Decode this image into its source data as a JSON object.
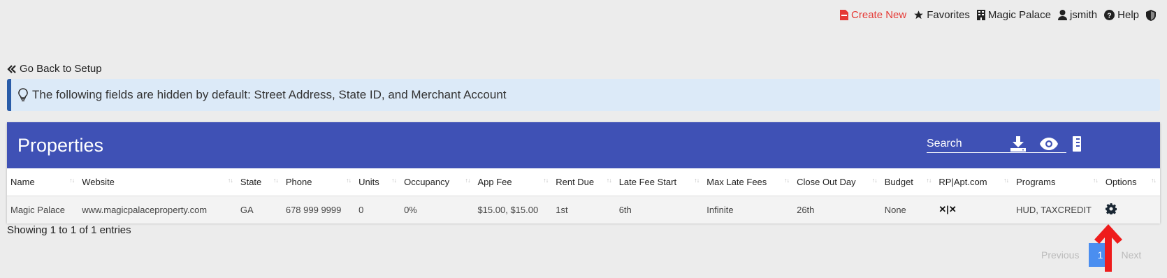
{
  "nav": {
    "create_new": "Create New",
    "favorites": "Favorites",
    "property": "Magic Palace",
    "user": "jsmith",
    "help": "Help"
  },
  "back_link": "Go Back to Setup",
  "alert_text": "The following fields are hidden by default: Street Address, State ID, and Merchant Account",
  "card": {
    "title": "Properties",
    "search_placeholder": "Search"
  },
  "table": {
    "columns": [
      "Name",
      "Website",
      "State",
      "Phone",
      "Units",
      "Occupancy",
      "App Fee",
      "Rent Due",
      "Late Fee Start",
      "Max Late Fees",
      "Close Out Day",
      "Budget",
      "RP|Apt.com",
      "Programs",
      "Options"
    ],
    "rows": [
      {
        "name": "Magic Palace",
        "website": "www.magicpalaceproperty.com",
        "state": "GA",
        "phone": "678 999 9999",
        "units": "0",
        "occupancy": "0%",
        "app_fee": "$15.00, $15.00",
        "rent_due": "1st",
        "late_fee_start": "6th",
        "max_late_fees": "Infinite",
        "close_out_day": "26th",
        "budget": "None",
        "rp_apt": "✕|✕",
        "programs": "HUD, TAXCREDIT"
      }
    ]
  },
  "info_text": "Showing 1 to 1 of 1 entries",
  "pagination": {
    "previous": "Previous",
    "current": "1",
    "next": "Next"
  },
  "colors": {
    "header_bg": "#3f51b5",
    "accent_red": "#e53935",
    "alert_bg": "#dceaf8",
    "page_active": "#4a8ef0"
  }
}
